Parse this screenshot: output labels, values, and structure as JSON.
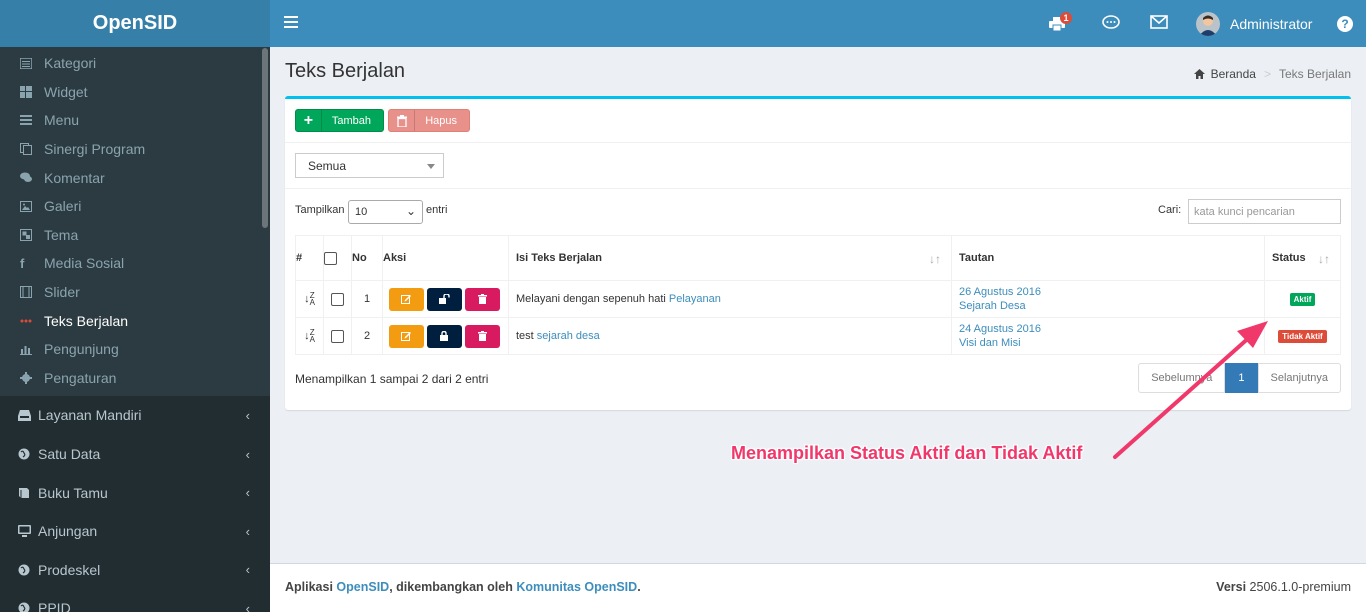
{
  "brand": "OpenSID",
  "sidebar": {
    "submenu": [
      {
        "label": "Kategori",
        "icon": "list-icon"
      },
      {
        "label": "Widget",
        "icon": "windows-icon"
      },
      {
        "label": "Menu",
        "icon": "bars-icon"
      },
      {
        "label": "Sinergi Program",
        "icon": "copy-icon"
      },
      {
        "label": "Komentar",
        "icon": "comments-icon"
      },
      {
        "label": "Galeri",
        "icon": "image-icon"
      },
      {
        "label": "Tema",
        "icon": "object-group-icon"
      },
      {
        "label": "Media Sosial",
        "icon": "facebook-icon"
      },
      {
        "label": "Slider",
        "icon": "film-icon"
      },
      {
        "label": "Teks Berjalan",
        "icon": "ellipsis-icon",
        "active": true
      },
      {
        "label": "Pengunjung",
        "icon": "bar-chart-icon"
      },
      {
        "label": "Pengaturan",
        "icon": "gear-icon"
      }
    ],
    "mainmenu": [
      {
        "label": "Layanan Mandiri",
        "icon": "inbox-icon"
      },
      {
        "label": "Satu Data",
        "icon": "globe-icon"
      },
      {
        "label": "Buku Tamu",
        "icon": "book-icon"
      },
      {
        "label": "Anjungan",
        "icon": "desktop-icon"
      },
      {
        "label": "Prodeskel",
        "icon": "globe-icon"
      },
      {
        "label": "PPID",
        "icon": "globe-icon"
      }
    ]
  },
  "header": {
    "notif_count": "1",
    "user_name": "Administrator",
    "help": "?"
  },
  "page": {
    "title": "Teks Berjalan",
    "breadcrumb_home": "Beranda",
    "breadcrumb_current": "Teks Berjalan"
  },
  "toolbar": {
    "add_label": "Tambah",
    "delete_label": "Hapus"
  },
  "filter": {
    "selected": "Semua"
  },
  "table_controls": {
    "show_label": "Tampilkan",
    "page_length": "10",
    "entries_label": "entri",
    "search_label": "Cari:",
    "search_placeholder": "kata kunci pencarian"
  },
  "table": {
    "headers": {
      "hash": "#",
      "no": "No",
      "action": "Aksi",
      "text": "Isi Teks Berjalan",
      "link": "Tautan",
      "status": "Status"
    },
    "rows": [
      {
        "no": "1",
        "text": "Melayani dengan sepenuh hati",
        "text_link": "Pelayanan",
        "link_date": "26 Agustus 2016",
        "link_title": "Sejarah Desa",
        "status": "Aktif",
        "status_color": "#00a65a",
        "lock_icon": "unlock-icon"
      },
      {
        "no": "2",
        "text": "test",
        "text_link": "sejarah desa",
        "link_date": "24 Agustus 2016",
        "link_title": "Visi dan Misi",
        "status": "Tidak Aktif",
        "status_color": "#dd4b39",
        "lock_icon": "lock-icon"
      }
    ]
  },
  "pagination": {
    "info": "Menampilkan 1 sampai 2 dari 2 entri",
    "prev": "Sebelumnya",
    "current": "1",
    "next": "Selanjutnya"
  },
  "footer": {
    "left_prefix": "Aplikasi",
    "left_app": "OpenSID",
    "left_mid": ", dikembangkan oleh",
    "left_org": "Komunitas OpenSID",
    "left_end": ".",
    "version_label": "Versi",
    "version": "2506.1.0-premium"
  },
  "annotation": "Menampilkan Status Aktif dan Tidak Aktif",
  "colors": {
    "accent": "#3c8dbc",
    "annotation": "#f0386b"
  }
}
